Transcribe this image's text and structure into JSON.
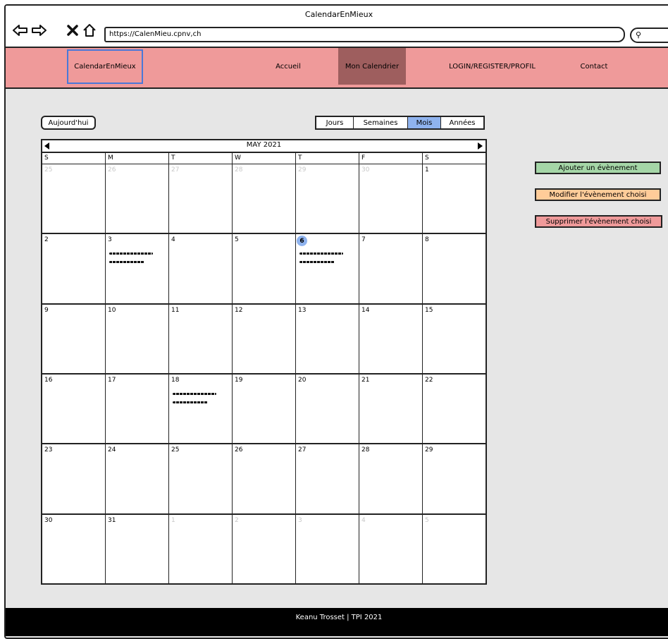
{
  "window": {
    "title": "CalendarEnMieux"
  },
  "browser": {
    "url": "https://CalenMieu.cpnv,ch"
  },
  "navbar": {
    "brand": "CalendarEnMieux",
    "links": [
      "Accueil",
      "Mon Calendrier",
      "LOGIN/REGISTER/PROFIL",
      "Contact"
    ],
    "active": "Mon Calendrier"
  },
  "controls": {
    "today_label": "Aujourd'hui",
    "views": [
      "Jours",
      "Semaines",
      "Mois",
      "Années"
    ],
    "active_view": "Mois"
  },
  "calendar": {
    "month_label": "MAY 2021",
    "weekdays": [
      "S",
      "M",
      "T",
      "W",
      "T",
      "F",
      "S"
    ],
    "weeks": [
      [
        "25",
        "26",
        "27",
        "28",
        "29",
        "30",
        "1"
      ],
      [
        "2",
        "3",
        "4",
        "5",
        "6",
        "7",
        "8"
      ],
      [
        "9",
        "10",
        "11",
        "12",
        "13",
        "14",
        "15"
      ],
      [
        "16",
        "17",
        "18",
        "19",
        "20",
        "21",
        "22"
      ],
      [
        "23",
        "24",
        "25",
        "26",
        "27",
        "28",
        "29"
      ],
      [
        "30",
        "31",
        "1",
        "2",
        "3",
        "4",
        "5"
      ]
    ],
    "today": "6"
  },
  "actions": {
    "add": "Ajouter un évènement",
    "edit": "Modifier l'évènement choisi",
    "delete": "Supprimer l'évènement choisi"
  },
  "footer": {
    "text": "Keanu Trosset | TPI 2021"
  },
  "colors": {
    "navbar": "#ef9a9a",
    "nav_active": "#9e5e5e",
    "brand_border": "#4a78d8",
    "active_view": "#8fb3ee",
    "add_button": "#a5d6a7",
    "edit_button": "#ffcc99",
    "delete_button": "#ef9a9a"
  }
}
